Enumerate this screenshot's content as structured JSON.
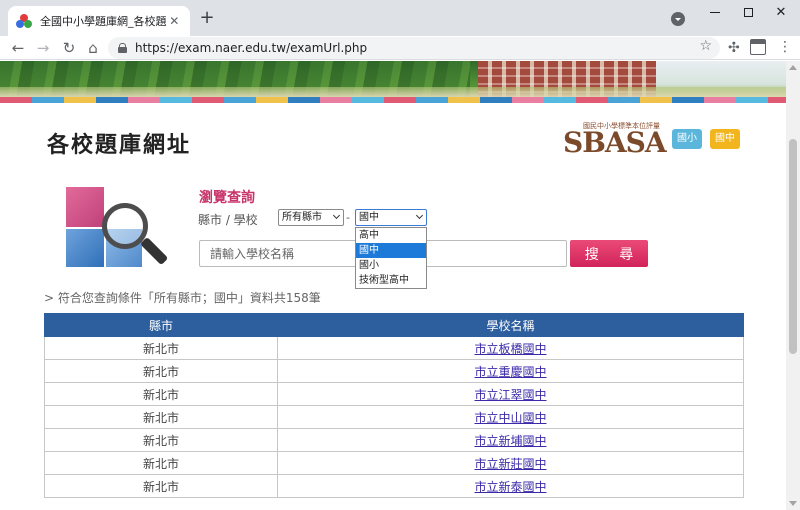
{
  "browser": {
    "tab_title": "全國中小學題庫網_各校題庫網址",
    "tab_close": "✕",
    "new_tab": "+",
    "url": "https://exam.naer.edu.tw/examUrl.php"
  },
  "header": {
    "title": "各校題庫網址",
    "logo_sub": "國民中小學標準本位評量",
    "logo_text": "SBASA",
    "level_buttons": [
      "國小",
      "國中"
    ]
  },
  "search": {
    "browse_label": "瀏覽查詢",
    "region_label": "縣市 / 學校",
    "county_select": "所有縣市",
    "separator": "-",
    "level_select": "國中",
    "level_options": [
      "高中",
      "國中",
      "國小",
      "技術型高中"
    ],
    "level_selected_index": 1,
    "school_placeholder": "請輸入學校名稱",
    "search_button": "搜 尋"
  },
  "results": {
    "summary": "> 符合您查詢條件「所有縣市；國中」資料共158筆",
    "columns": [
      "縣市",
      "學校名稱"
    ],
    "rows": [
      {
        "county": "新北市",
        "school": "市立板橋國中"
      },
      {
        "county": "新北市",
        "school": "市立重慶國中"
      },
      {
        "county": "新北市",
        "school": "市立江翠國中"
      },
      {
        "county": "新北市",
        "school": "市立中山國中"
      },
      {
        "county": "新北市",
        "school": "市立新埔國中"
      },
      {
        "county": "新北市",
        "school": "市立新莊國中"
      },
      {
        "county": "新北市",
        "school": "市立新泰國中"
      }
    ]
  },
  "colors": {
    "accent_pink": "#d1245a",
    "table_header": "#2d5e9e",
    "dropdown_highlight": "#1e7ad8",
    "link": "#3a2aa8"
  },
  "icons": {
    "back": "back-arrow-icon",
    "forward": "forward-arrow-icon",
    "reload": "reload-icon",
    "home": "home-icon",
    "lock": "lock-icon",
    "star": "bookmark-star-icon",
    "extensions": "puzzle-icon",
    "menu": "kebab-menu-icon",
    "search_graphic": "magnifier-icon"
  }
}
